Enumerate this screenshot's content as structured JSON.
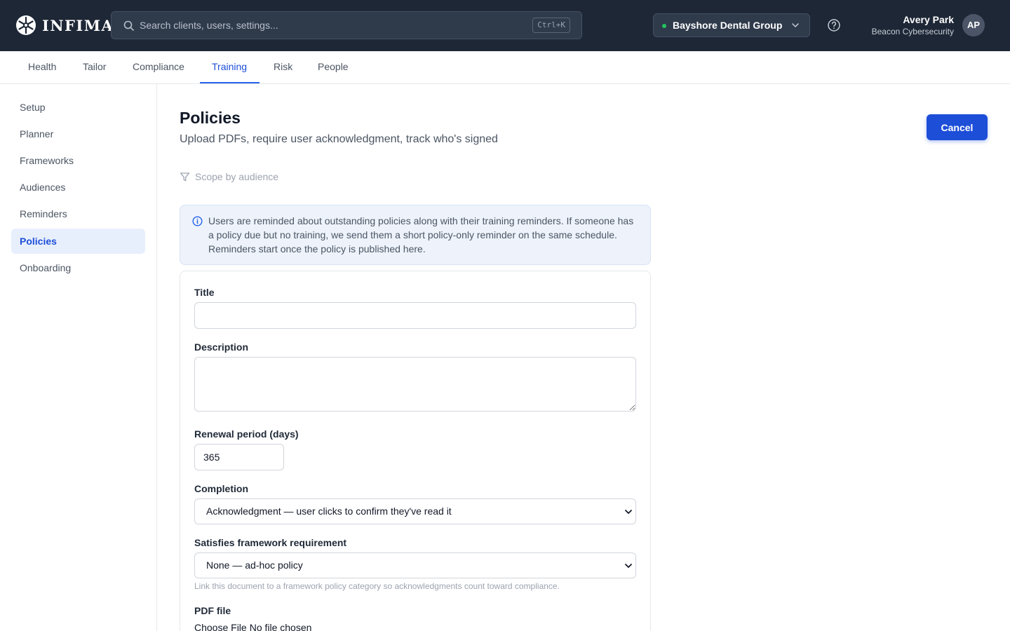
{
  "brand": {
    "name": "INFIMA"
  },
  "search": {
    "placeholder": "Search clients, users, settings...",
    "shortcut": "Ctrl+K"
  },
  "client_selector": {
    "label": "Bayshore Dental Group",
    "status_color": "#22c55e"
  },
  "user": {
    "name": "Avery Park",
    "org": "Beacon Cybersecurity",
    "initials": "AP"
  },
  "tabs": [
    {
      "label": "Health"
    },
    {
      "label": "Tailor"
    },
    {
      "label": "Compliance"
    },
    {
      "label": "Training",
      "active": true
    },
    {
      "label": "Risk"
    },
    {
      "label": "People"
    }
  ],
  "sidebar": {
    "items": [
      {
        "label": "Setup"
      },
      {
        "label": "Planner"
      },
      {
        "label": "Frameworks"
      },
      {
        "label": "Audiences"
      },
      {
        "label": "Reminders"
      },
      {
        "label": "Policies",
        "active": true
      },
      {
        "label": "Onboarding"
      }
    ]
  },
  "page": {
    "title": "Policies",
    "subtitle": "Upload PDFs, require user acknowledgment, track who's signed",
    "cancel_label": "Cancel",
    "scope_label": "Scope by audience",
    "info_text": "Users are reminded about outstanding policies along with their training reminders. If someone has a policy due but no training, we send them a short policy-only reminder on the same schedule. Reminders start once the policy is published here."
  },
  "form": {
    "title_label": "Title",
    "title_value": "",
    "description_label": "Description",
    "description_value": "",
    "renewal_label": "Renewal period (days)",
    "renewal_value": "365",
    "completion_label": "Completion",
    "completion_value": "Acknowledgment — user clicks to confirm they've read it",
    "framework_label": "Satisfies framework requirement",
    "framework_value": "None — ad-hoc policy",
    "framework_help": "Link this document to a framework policy category so acknowledgments count toward compliance.",
    "pdf_label": "PDF file",
    "file_button": "Choose File",
    "file_status": "No file chosen"
  },
  "colors": {
    "accent": "#1d4ed8",
    "topbar": "#1e2736",
    "active_nav_bg": "#e8effc"
  }
}
